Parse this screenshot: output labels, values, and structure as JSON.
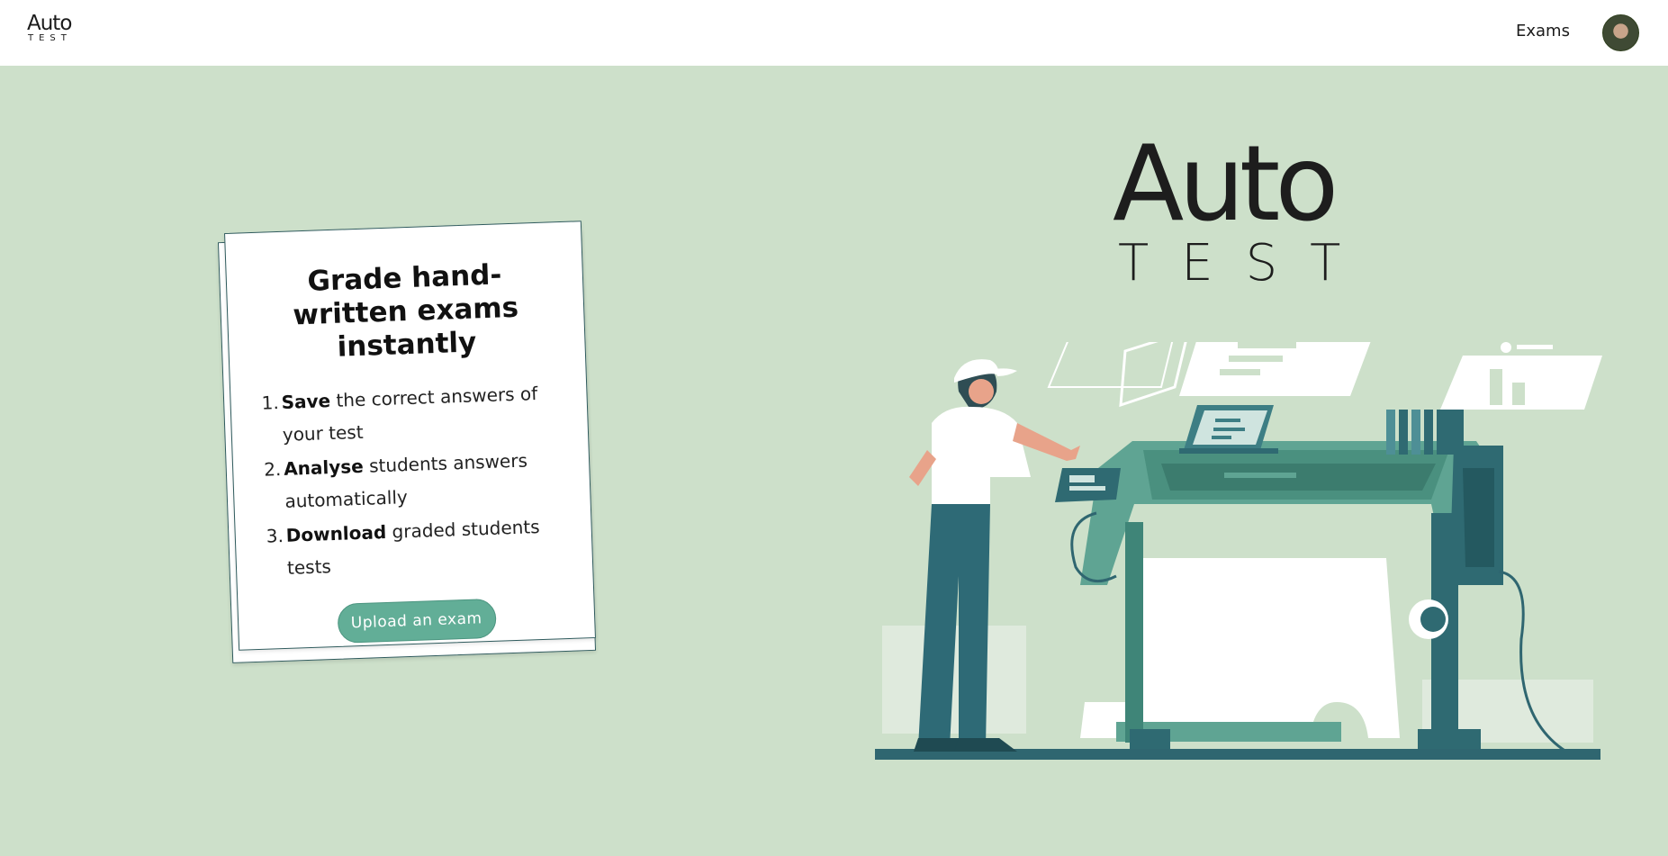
{
  "header": {
    "logo": {
      "primary": "Auto",
      "secondary": "TEST"
    },
    "nav": {
      "exams_label": "Exams"
    },
    "avatar_alt": "user avatar"
  },
  "card": {
    "title": "Grade hand-written exams instantly",
    "steps": [
      {
        "number": "1.",
        "bold": "Save",
        "rest": " the correct answers of your test"
      },
      {
        "number": "2.",
        "bold": "Analyse",
        "rest": " students answers automatically"
      },
      {
        "number": "3.",
        "bold": "Download",
        "rest": " graded students tests"
      }
    ],
    "upload_button_label": "Upload an exam"
  },
  "hero": {
    "brand_primary": "Auto",
    "brand_secondary": "TEST"
  },
  "colors": {
    "background": "#cde0ca",
    "accent": "#62ae97",
    "teal_dark": "#2e6a6f",
    "teal_mid": "#4e9a89",
    "text": "#1b1b1b"
  }
}
